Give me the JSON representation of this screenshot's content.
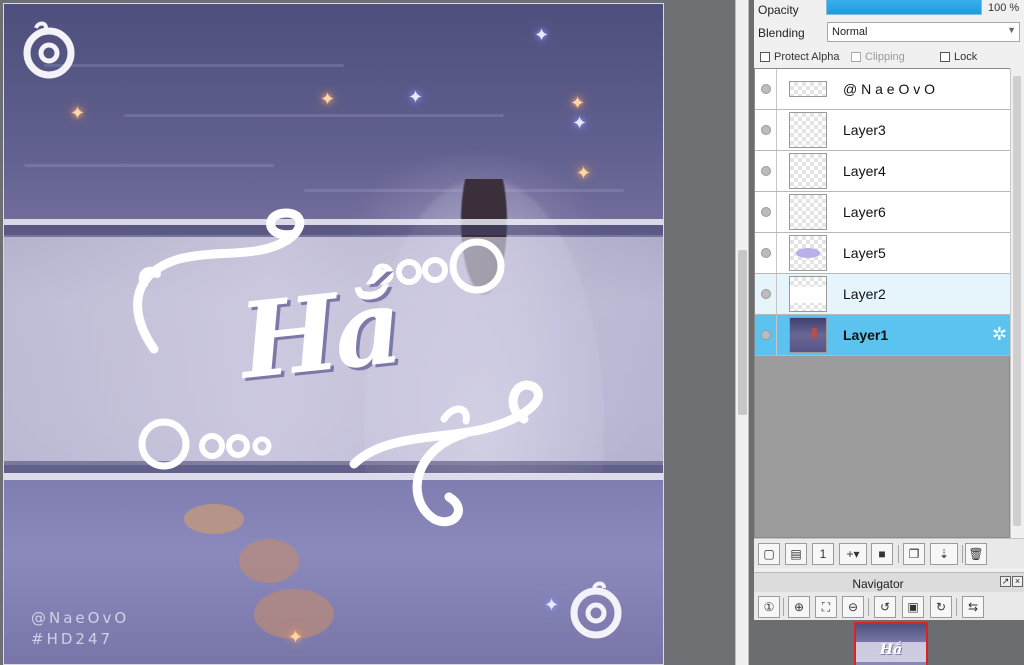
{
  "canvas": {
    "main_text": "Hắ",
    "watermark_line1": "@NaeOvO",
    "watermark_line2": "#HD247"
  },
  "layer_properties": {
    "opacity_label": "Opacity",
    "opacity_value": "100 %",
    "opacity_percent": 100,
    "blending_label": "Blending",
    "blending_value": "Normal",
    "protect_alpha_label": "Protect Alpha",
    "clipping_label": "Clipping",
    "lock_label": "Lock"
  },
  "layers": [
    {
      "name": "@ N a e O v O",
      "selected": false
    },
    {
      "name": "Layer3",
      "selected": false
    },
    {
      "name": "Layer4",
      "selected": false
    },
    {
      "name": "Layer6",
      "selected": false
    },
    {
      "name": "Layer5",
      "selected": false
    },
    {
      "name": "Layer2",
      "selected": false
    },
    {
      "name": "Layer1",
      "selected": true
    }
  ],
  "layer_toolbar": {
    "icons": [
      "new-layer-icon",
      "new-halftone-layer-icon",
      "new-1bit-layer-icon",
      "add-layer-menu-icon",
      "new-folder-icon",
      "duplicate-layer-icon",
      "merge-down-icon",
      "delete-layer-icon"
    ]
  },
  "navigator": {
    "title": "Navigator",
    "preview_text": "Hắ",
    "icons": [
      "zoom-reset-icon",
      "zoom-in-icon",
      "fit-icon",
      "zoom-out-icon",
      "rotate-left-icon",
      "rotate-reset-icon",
      "rotate-right-icon",
      "flip-icon"
    ]
  },
  "colors": {
    "selected_layer": "#5cc2f0",
    "opacity_bar": "#1e9be0",
    "workspace": "#6b6d70"
  }
}
